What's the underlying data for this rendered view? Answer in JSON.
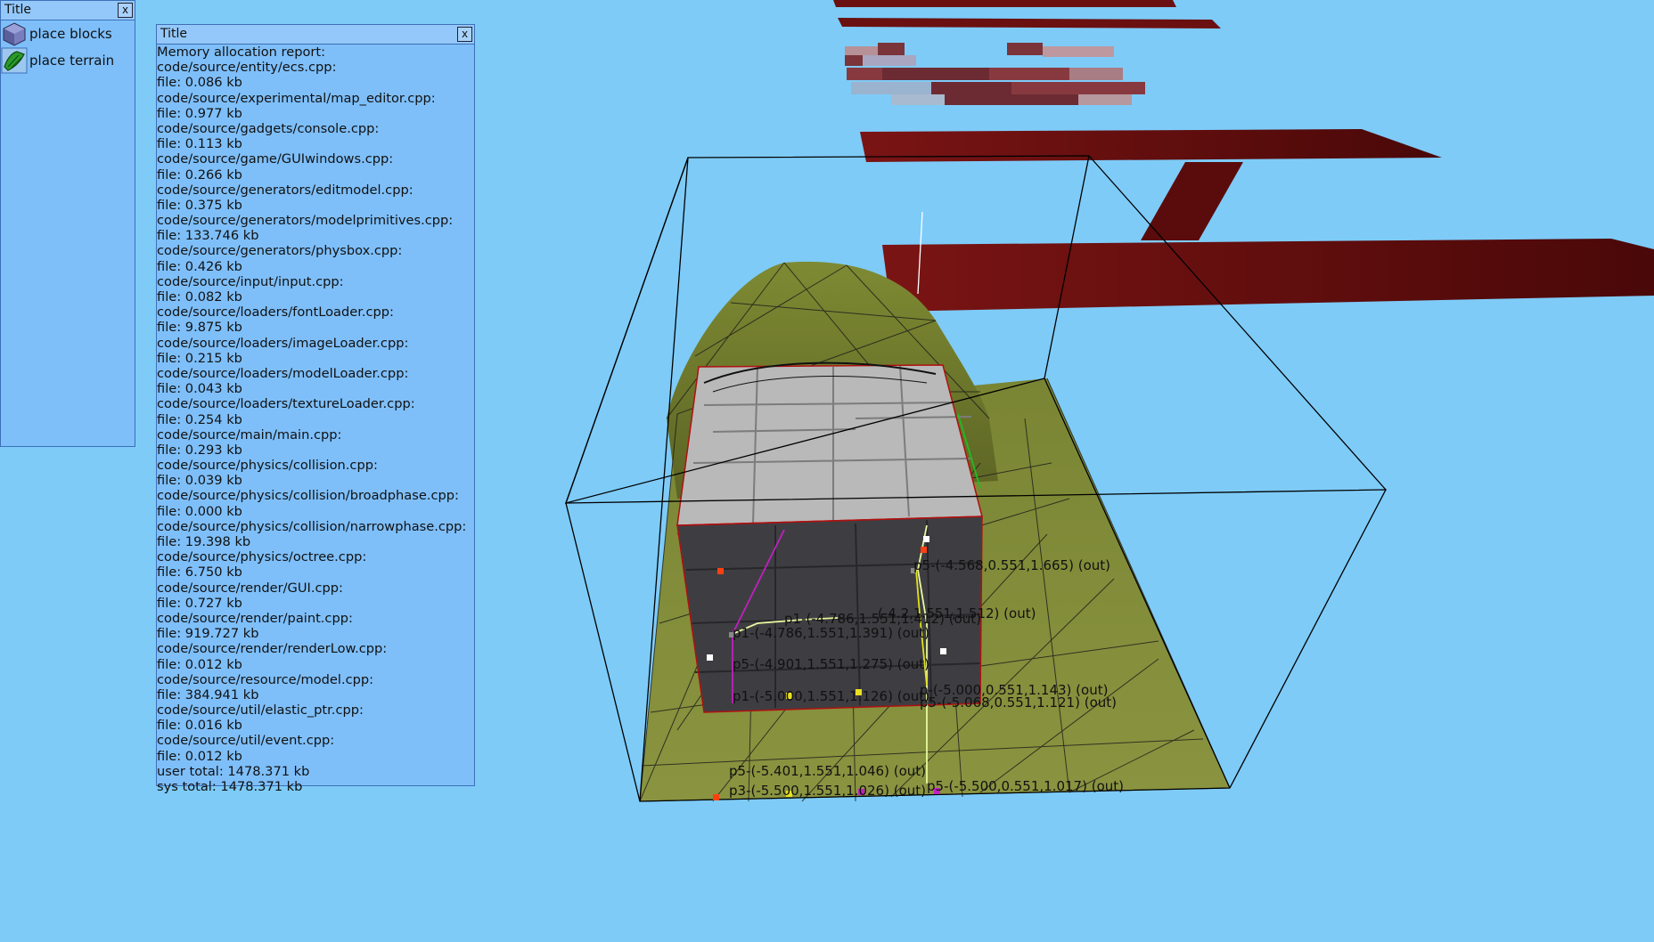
{
  "tools_window": {
    "title": "Title",
    "close_label": "x",
    "items": [
      {
        "label": "place blocks",
        "icon": "cube-icon"
      },
      {
        "label": "place terrain",
        "icon": "terrain-icon"
      }
    ]
  },
  "memory_window": {
    "title": "Title",
    "close_label": "x",
    "lines": [
      "Memory allocation report:",
      "code/source/entity/ecs.cpp:",
      "file: 0.086 kb",
      "code/source/experimental/map_editor.cpp:",
      "file: 0.977 kb",
      "code/source/gadgets/console.cpp:",
      "file: 0.113 kb",
      "code/source/game/GUIwindows.cpp:",
      "file: 0.266 kb",
      "code/source/generators/editmodel.cpp:",
      "file: 0.375 kb",
      "code/source/generators/modelprimitives.cpp:",
      "file: 133.746 kb",
      "code/source/generators/physbox.cpp:",
      "file: 0.426 kb",
      "code/source/input/input.cpp:",
      "file: 0.082 kb",
      "code/source/loaders/fontLoader.cpp:",
      "file: 9.875 kb",
      "code/source/loaders/imageLoader.cpp:",
      "file: 0.215 kb",
      "code/source/loaders/modelLoader.cpp:",
      "file: 0.043 kb",
      "code/source/loaders/textureLoader.cpp:",
      "file: 0.254 kb",
      "code/source/main/main.cpp:",
      "file: 0.293 kb",
      "code/source/physics/collision.cpp:",
      "file: 0.039 kb",
      "code/source/physics/collision/broadphase.cpp:",
      "file: 0.000 kb",
      "code/source/physics/collision/narrowphase.cpp:",
      "file: 19.398 kb",
      "code/source/physics/octree.cpp:",
      "file: 6.750 kb",
      "code/source/render/GUI.cpp:",
      "file: 0.727 kb",
      "code/source/render/paint.cpp:",
      "file: 919.727 kb",
      "code/source/render/renderLow.cpp:",
      "file: 0.012 kb",
      "code/source/resource/model.cpp:",
      "file: 384.941 kb",
      "code/source/util/elastic_ptr.cpp:",
      "file: 0.016 kb",
      "code/source/util/event.cpp:",
      "file: 0.012 kb",
      "user total: 1478.371 kb",
      "sys  total: 1478.371 kb"
    ]
  },
  "scene": {
    "debug_labels": [
      "p5-(-4.568,0.551,1.665) (out)",
      "p1-(-4.786,1.551,1.391) (out)",
      "p5-(-4.901,1.551,1.275) (out)",
      "p1-(-5.000,1.551,1.126) (out)",
      "p-(-5.000,0.551,1.143) (out)",
      "p5-(-5.068,0.551,1.121) (out)",
      "p5-(-5.401,1.551,1.046) (out)",
      "p3-(-5.500,1.551,1.026) (out)",
      "p5-(-5.500,0.551,1.017) (out)",
      "p1-(-4.786,1.551,1.412) (out)",
      "(-4.2,1.551,1.512) (out)"
    ],
    "colors": {
      "sky": "#7ecbf8",
      "floating_plane": "#5a0c0c",
      "terrain": "#6f7a2c",
      "block_top": "#b8b8b8",
      "block_side": "#3a3a3e"
    }
  }
}
